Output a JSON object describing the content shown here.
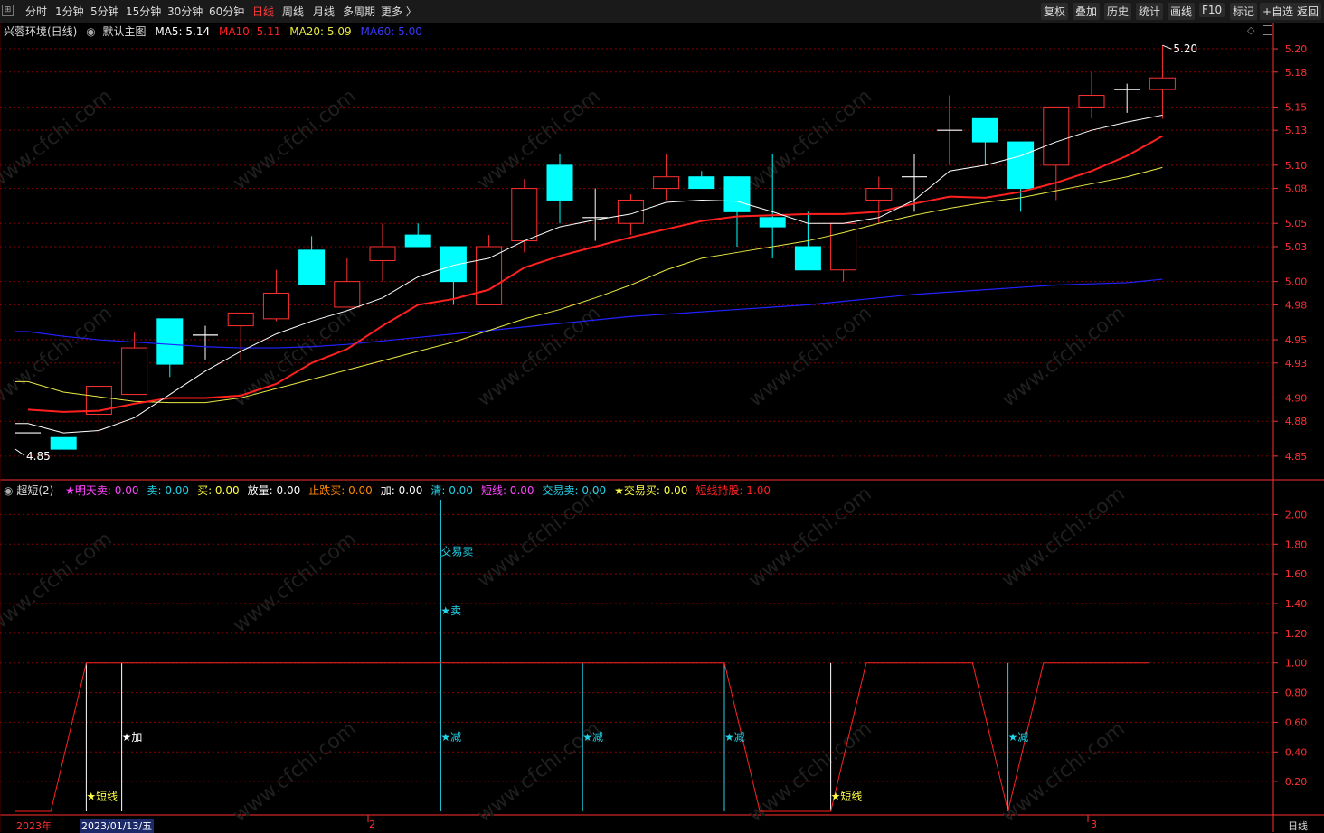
{
  "toolbar": {
    "left": [
      "分时",
      "1分钟",
      "5分钟",
      "15分钟",
      "30分钟",
      "60分钟",
      "日线",
      "周线",
      "月线",
      "多周期",
      "更多 〉"
    ],
    "active": "日线",
    "right": [
      "复权",
      "叠加",
      "历史",
      "统计",
      "画线",
      "F10",
      "标记",
      "+自选",
      "返回"
    ]
  },
  "main_legend": {
    "title": "兴蓉环境(日线)",
    "main_chart": "默认主图",
    "ma5": "MA5: 5.14",
    "ma10": "MA10: 5.11",
    "ma20": "MA20: 5.09",
    "ma60": "MA60: 5.00"
  },
  "sub_legend": {
    "name": "超短(2)",
    "items": [
      {
        "text": "★明天卖: 0.00",
        "color": "#ff44ff"
      },
      {
        "text": "卖: 0.00",
        "color": "#22d3e8"
      },
      {
        "text": "买: 0.00",
        "color": "#ffff44"
      },
      {
        "text": "放量: 0.00",
        "color": "#ffffff"
      },
      {
        "text": "止跌买: 0.00",
        "color": "#ff8800"
      },
      {
        "text": "加: 0.00",
        "color": "#ffffff"
      },
      {
        "text": "清: 0.00",
        "color": "#22d3e8"
      },
      {
        "text": "短线: 0.00",
        "color": "#ff44ff"
      },
      {
        "text": "交易卖: 0.00",
        "color": "#22d3e8"
      },
      {
        "text": "★交易买: 0.00",
        "color": "#ffff44"
      },
      {
        "text": "短线持股: 1.00",
        "color": "#ff2222"
      }
    ]
  },
  "colors": {
    "up": "#ff3030",
    "down": "#00ffff",
    "ma5": "#ffffff",
    "ma10": "#ff2020",
    "ma20": "#e8e844",
    "ma60": "#2222ff",
    "grid": "#8b0000",
    "axis": "#ff3030"
  },
  "chart_data": [
    {
      "type": "candlestick",
      "title": "兴蓉环境(日线)",
      "y_ticks": [
        "5.20",
        "5.18",
        "5.15",
        "5.13",
        "5.10",
        "5.08",
        "5.05",
        "5.03",
        "5.00",
        "4.98",
        "4.95",
        "4.93",
        "4.90",
        "4.88",
        "4.85"
      ],
      "ylim": [
        4.846,
        5.207
      ],
      "candles": [
        {
          "o": 4.87,
          "h": 4.87,
          "l": 4.87,
          "c": 4.87
        },
        {
          "o": 4.866,
          "h": 4.866,
          "l": 4.856,
          "c": 4.856
        },
        {
          "o": 4.886,
          "h": 4.91,
          "l": 4.866,
          "c": 4.91
        },
        {
          "o": 4.903,
          "h": 4.956,
          "l": 4.903,
          "c": 4.943
        },
        {
          "o": 4.968,
          "h": 4.968,
          "l": 4.918,
          "c": 4.929
        },
        {
          "o": 4.954,
          "h": 4.962,
          "l": 4.933,
          "c": 4.954
        },
        {
          "o": 4.962,
          "h": 4.973,
          "l": 4.932,
          "c": 4.973
        },
        {
          "o": 4.968,
          "h": 5.01,
          "l": 4.966,
          "c": 4.99
        },
        {
          "o": 5.027,
          "h": 5.039,
          "l": 4.997,
          "c": 4.997
        },
        {
          "o": 4.978,
          "h": 5.02,
          "l": 4.978,
          "c": 5.0
        },
        {
          "o": 5.018,
          "h": 5.05,
          "l": 5.0,
          "c": 5.03
        },
        {
          "o": 5.04,
          "h": 5.05,
          "l": 5.03,
          "c": 5.03
        },
        {
          "o": 5.03,
          "h": 5.03,
          "l": 4.98,
          "c": 5.0
        },
        {
          "o": 4.98,
          "h": 5.04,
          "l": 4.98,
          "c": 5.03
        },
        {
          "o": 5.035,
          "h": 5.088,
          "l": 5.025,
          "c": 5.08
        },
        {
          "o": 5.1,
          "h": 5.11,
          "l": 5.05,
          "c": 5.07
        },
        {
          "o": 5.055,
          "h": 5.08,
          "l": 5.035,
          "c": 5.055
        },
        {
          "o": 5.05,
          "h": 5.075,
          "l": 5.04,
          "c": 5.07
        },
        {
          "o": 5.08,
          "h": 5.11,
          "l": 5.07,
          "c": 5.09
        },
        {
          "o": 5.09,
          "h": 5.095,
          "l": 5.08,
          "c": 5.08
        },
        {
          "o": 5.09,
          "h": 5.09,
          "l": 5.03,
          "c": 5.06
        },
        {
          "o": 5.055,
          "h": 5.11,
          "l": 5.02,
          "c": 5.047
        },
        {
          "o": 5.03,
          "h": 5.06,
          "l": 5.01,
          "c": 5.01
        },
        {
          "o": 5.01,
          "h": 5.05,
          "l": 5.0,
          "c": 5.05
        },
        {
          "o": 5.07,
          "h": 5.09,
          "l": 5.05,
          "c": 5.08
        },
        {
          "o": 5.09,
          "h": 5.11,
          "l": 5.06,
          "c": 5.09
        },
        {
          "o": 5.13,
          "h": 5.16,
          "l": 5.1,
          "c": 5.13
        },
        {
          "o": 5.14,
          "h": 5.14,
          "l": 5.1,
          "c": 5.12
        },
        {
          "o": 5.12,
          "h": 5.12,
          "l": 5.06,
          "c": 5.08
        },
        {
          "o": 5.1,
          "h": 5.15,
          "l": 5.07,
          "c": 5.15
        },
        {
          "o": 5.15,
          "h": 5.18,
          "l": 5.14,
          "c": 5.16
        },
        {
          "o": 5.165,
          "h": 5.17,
          "l": 5.145,
          "c": 5.165
        },
        {
          "o": 5.165,
          "h": 5.203,
          "l": 5.14,
          "c": 5.175
        }
      ],
      "ma": {
        "MA5": [
          4.878,
          4.87,
          4.872,
          4.883,
          4.903,
          4.923,
          4.94,
          4.955,
          4.966,
          4.975,
          4.986,
          5.004,
          5.014,
          5.02,
          5.035,
          5.047,
          5.053,
          5.058,
          5.068,
          5.07,
          5.069,
          5.06,
          5.05,
          5.05,
          5.055,
          5.07,
          5.095,
          5.1,
          5.108,
          5.12,
          5.13,
          5.137,
          5.143
        ],
        "MA10": [
          4.89,
          4.888,
          4.889,
          4.895,
          4.9,
          4.9,
          4.902,
          4.912,
          4.93,
          4.942,
          4.962,
          4.98,
          4.985,
          4.993,
          5.012,
          5.022,
          5.03,
          5.038,
          5.045,
          5.052,
          5.056,
          5.057,
          5.058,
          5.058,
          5.06,
          5.067,
          5.073,
          5.072,
          5.077,
          5.085,
          5.095,
          5.108,
          5.125
        ],
        "MA20": [
          4.914,
          4.905,
          4.901,
          4.897,
          4.896,
          4.896,
          4.9,
          4.908,
          4.916,
          4.924,
          4.932,
          4.94,
          4.948,
          4.958,
          4.968,
          4.976,
          4.986,
          4.997,
          5.01,
          5.02,
          5.025,
          5.03,
          5.035,
          5.042,
          5.05,
          5.057,
          5.063,
          5.068,
          5.072,
          5.078,
          5.084,
          5.09,
          5.098
        ],
        "MA60": [
          4.957,
          4.953,
          4.95,
          4.948,
          4.946,
          4.944,
          4.943,
          4.943,
          4.944,
          4.946,
          4.949,
          4.952,
          4.955,
          4.958,
          4.961,
          4.964,
          4.967,
          4.97,
          4.972,
          4.974,
          4.976,
          4.978,
          4.98,
          4.983,
          4.986,
          4.989,
          4.991,
          4.993,
          4.995,
          4.997,
          4.998,
          4.999,
          5.002
        ]
      },
      "annotations": [
        {
          "text": "5.20",
          "at": "high"
        },
        {
          "text": "4.85",
          "at": "low"
        }
      ]
    },
    {
      "type": "line",
      "title": "超短(2)",
      "y_ticks": [
        "2.00",
        "1.80",
        "1.60",
        "1.40",
        "1.20",
        "1.00",
        "0.80",
        "0.60",
        "0.40",
        "0.20"
      ],
      "ylim": [
        0,
        2.1
      ],
      "series": [
        {
          "name": "短线持股",
          "points": [
            [
              0,
              0
            ],
            [
              1,
              0
            ],
            [
              2,
              1
            ],
            [
              14,
              1
            ],
            [
              20,
              1
            ],
            [
              21,
              0
            ],
            [
              22,
              0
            ],
            [
              23,
              0
            ],
            [
              24,
              1
            ],
            [
              27,
              1
            ],
            [
              28,
              0
            ],
            [
              29,
              1
            ],
            [
              32,
              1
            ]
          ]
        }
      ],
      "vlines": [
        {
          "bar": 2,
          "color": "#ffffff",
          "top": 1
        },
        {
          "bar": 3,
          "color": "#ffffff",
          "top": 1
        },
        {
          "bar": 12,
          "color": "#22d3e8",
          "top": 2.1
        },
        {
          "bar": 16,
          "color": "#22d3e8",
          "top": 1
        },
        {
          "bar": 20,
          "color": "#22d3e8",
          "top": 1
        },
        {
          "bar": 23,
          "color": "#ffffff",
          "top": 1
        },
        {
          "bar": 28,
          "color": "#22d3e8",
          "top": 1
        }
      ],
      "labels": [
        {
          "bar": 2,
          "y": 0.1,
          "text": "★短线",
          "color": "#ffff44"
        },
        {
          "bar": 3,
          "y": 0.5,
          "text": "★加",
          "color": "#ffffff"
        },
        {
          "bar": 12,
          "y": 1.75,
          "text": "交易卖",
          "color": "#22d3e8"
        },
        {
          "bar": 12,
          "y": 1.35,
          "text": "★卖",
          "color": "#22d3e8"
        },
        {
          "bar": 12,
          "y": 0.5,
          "text": "★减",
          "color": "#22d3e8"
        },
        {
          "bar": 16,
          "y": 0.5,
          "text": "★减",
          "color": "#22d3e8"
        },
        {
          "bar": 20,
          "y": 0.5,
          "text": "★减",
          "color": "#22d3e8"
        },
        {
          "bar": 23,
          "y": 0.1,
          "text": "★短线",
          "color": "#ffff44"
        },
        {
          "bar": 28,
          "y": 0.5,
          "text": "★减",
          "color": "#22d3e8"
        }
      ]
    }
  ],
  "x_axis": {
    "year": "2023年",
    "date": "2023/01/13/五",
    "m2": "2",
    "m3": "3"
  },
  "period_label": "日线",
  "watermark": "www.cfchi.com"
}
